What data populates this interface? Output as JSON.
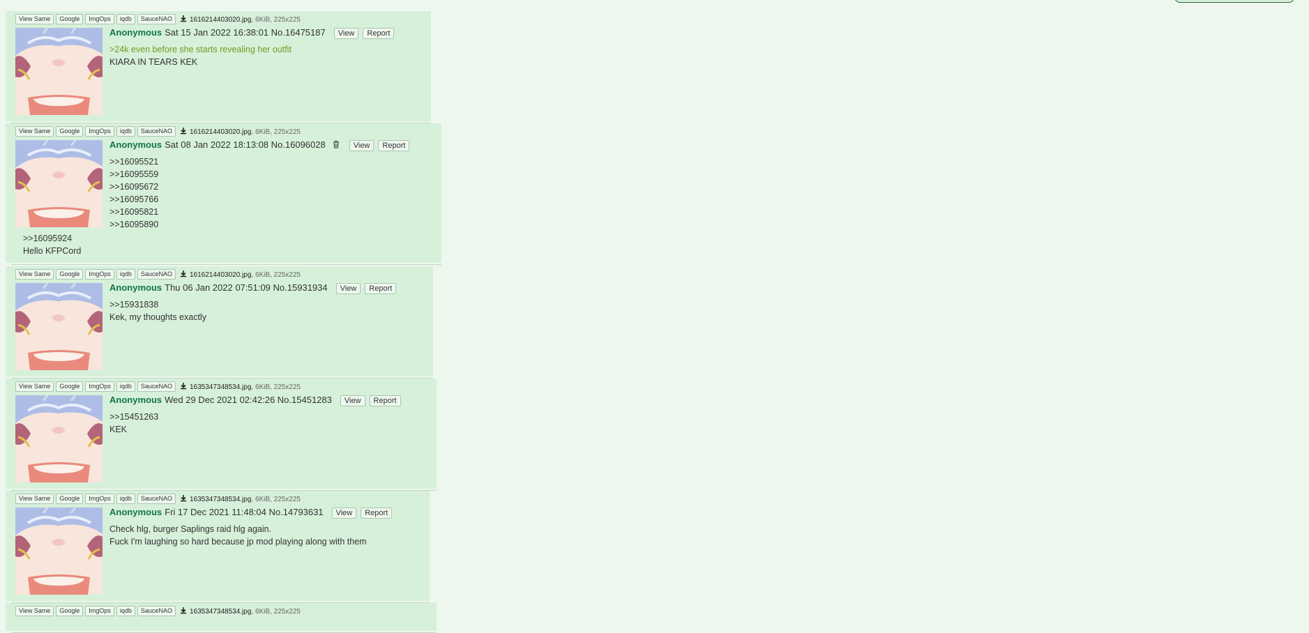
{
  "image_tools": [
    "View Same",
    "Google",
    "ImgOps",
    "iqdb",
    "SauceNAO"
  ],
  "header_buttons": {
    "view": "View",
    "report": "Report"
  },
  "posts": [
    {
      "file_name": "1616214403020.jpg",
      "file_meta": ", 6KiB, 225x225",
      "name": "Anonymous",
      "date": "Sat 15 Jan 2022 16:38:01",
      "post_no": "No.16475187",
      "lines": [
        {
          "text": ">24k even before she starts revealing her outfit",
          "greentext": true
        },
        {
          "text": "KIARA IN TEARS KEK",
          "greentext": false
        }
      ]
    },
    {
      "file_name": "1616214403020.jpg",
      "file_meta": ", 6KiB, 225x225",
      "name": "Anonymous",
      "date": "Sat 08 Jan 2022 18:13:08",
      "post_no": "No.16096028",
      "has_trash": true,
      "lines": [
        {
          "text": ">>16095521",
          "greentext": false
        },
        {
          "text": ">>16095559",
          "greentext": false
        },
        {
          "text": ">>16095672",
          "greentext": false
        },
        {
          "text": ">>16095766",
          "greentext": false
        },
        {
          "text": ">>16095821",
          "greentext": false
        },
        {
          "text": ">>16095890",
          "greentext": false
        }
      ],
      "lines_under": [
        {
          "text": ">>16095924"
        },
        {
          "text": "Hello KFPCord"
        }
      ]
    },
    {
      "file_name": "1616214403020.jpg",
      "file_meta": ", 6KiB, 225x225",
      "name": "Anonymous",
      "date": "Thu 06 Jan 2022 07:51:09",
      "post_no": "No.15931934",
      "lines": [
        {
          "text": ">>15931838",
          "greentext": false
        },
        {
          "text": "Kek, my thoughts exactly",
          "greentext": false
        }
      ]
    },
    {
      "file_name": "1635347348534.jpg",
      "file_meta": ", 6KiB, 225x225",
      "name": "Anonymous",
      "date": "Wed 29 Dec 2021 02:42:26",
      "post_no": "No.15451283",
      "lines": [
        {
          "text": ">>15451263",
          "greentext": false
        },
        {
          "text": "KEK",
          "greentext": false
        }
      ]
    },
    {
      "file_name": "1635347348534.jpg",
      "file_meta": ", 6KiB, 225x225",
      "name": "Anonymous",
      "date": "Fri 17 Dec 2021 11:48:04",
      "post_no": "No.14793631",
      "lines": [
        {
          "text": "Check hlg, burger Saplings raid hlg again.",
          "greentext": false
        },
        {
          "text": "Fuck I'm laughing so hard because jp mod playing along with them",
          "greentext": false
        }
      ]
    },
    {
      "file_name": "1635347348534.jpg",
      "file_meta": ", 6KiB, 225x225",
      "partial": true
    }
  ]
}
